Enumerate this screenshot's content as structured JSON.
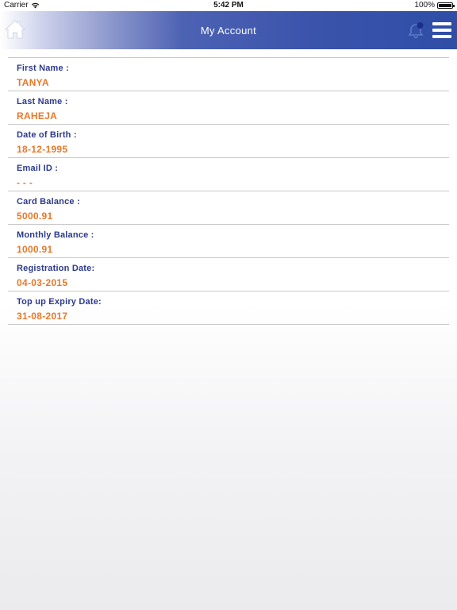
{
  "status_bar": {
    "carrier": "Carrier",
    "time": "5:42 PM",
    "battery": "100%"
  },
  "header": {
    "title": "My Account"
  },
  "icons": {
    "home": "home-icon",
    "bell": "bell-icon",
    "menu": "hamburger-menu-icon"
  },
  "colors": {
    "header_blue": "#2f4ea6",
    "label_blue": "#2b3a8c",
    "value_orange": "#e8782a",
    "divider": "#c9c9cc"
  },
  "fields": [
    {
      "label": "First Name :",
      "value": "TANYA"
    },
    {
      "label": "Last Name :",
      "value": "RAHEJA"
    },
    {
      "label": "Date of Birth :",
      "value": "18-12-1995"
    },
    {
      "label": "Email ID :",
      "value": "- - -"
    },
    {
      "label": "Card Balance :",
      "value": "5000.91"
    },
    {
      "label": "Monthly Balance :",
      "value": "1000.91"
    },
    {
      "label": "Registration Date:",
      "value": "04-03-2015"
    },
    {
      "label": "Top up Expiry Date:",
      "value": "31-08-2017"
    }
  ]
}
